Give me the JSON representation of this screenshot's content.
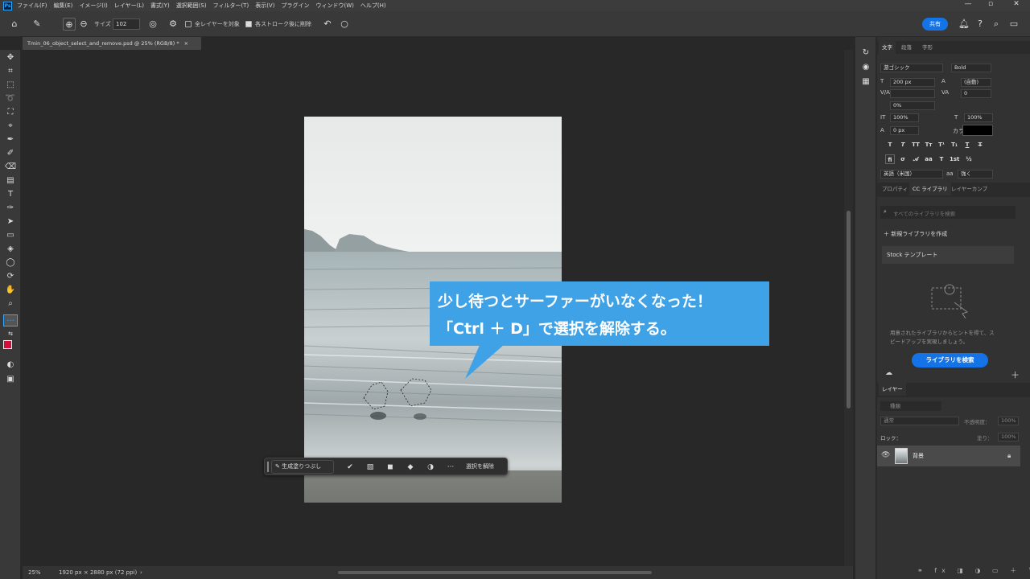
{
  "menubar": {
    "items": [
      "ファイル(F)",
      "編集(E)",
      "イメージ(I)",
      "レイヤー(L)",
      "書式(Y)",
      "選択範囲(S)",
      "フィルター(T)",
      "表示(V)",
      "プラグイン",
      "ウィンドウ(W)",
      "ヘルプ(H)"
    ],
    "app_logo": "Ps"
  },
  "options": {
    "size_label": "サイズ",
    "size_value": "102",
    "sample_all_layers": "全レイヤーを対象",
    "enhance_edge": "各ストローク後に削除",
    "share_label": "共有"
  },
  "document": {
    "tab_title": "Tmin_06_object_select_and_remove.psd @ 25% (RGB/8) *",
    "zoom": "25%",
    "dimensions": "1920 px × 2880 px (72 ppi)"
  },
  "taskbar": {
    "generate_label": "生成塗りつぶし",
    "deselect_label": "選択を解除"
  },
  "callout": {
    "line1": "少し待つとサーファーがいなくなった！",
    "line2": "「Ctrl ＋ D」で選択を解除する。",
    "color": "#3fa2e6"
  },
  "character_panel": {
    "tabs": [
      "文字",
      "段落",
      "字形"
    ],
    "font_family": "游ゴシック",
    "font_style": "Bold",
    "font_size": "200 px",
    "leading": "(自動)",
    "kerning": "",
    "tracking": "0",
    "tsume": "0%",
    "vertical_scale": "100%",
    "horizontal_scale": "100%",
    "baseline_shift": "0 px",
    "color_label": "カラー：",
    "language": "英語（米国）",
    "antialias": "強く",
    "aa_label": "aa"
  },
  "library_panel": {
    "tabs": [
      "プロパティ",
      "CC ライブラリ",
      "レイヤーカンプ"
    ],
    "search_placeholder": "すべてのライブラリを検索",
    "new_library": "新規ライブラリを作成",
    "stock_templates": "Stock テンプレート",
    "hint_line1": "用意されたライブラリからヒントを得て、ス",
    "hint_line2": "ピードアップを実現しましょう。",
    "search_button": "ライブラリを検索"
  },
  "layers_panel": {
    "tab": "レイヤー",
    "search_placeholder": "種類",
    "blend_mode": "通常",
    "opacity_label": "不透明度：",
    "opacity": "100%",
    "lock_label": "ロック：",
    "fill_label": "塗り：",
    "fill": "100%",
    "layers": [
      {
        "name": "背景",
        "locked": true
      }
    ]
  }
}
